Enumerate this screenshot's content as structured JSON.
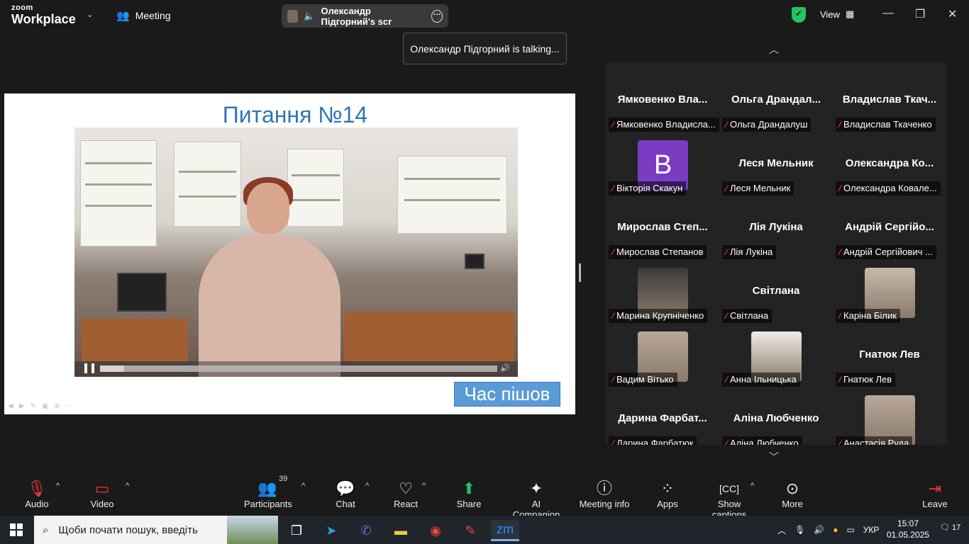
{
  "window": {
    "logo_top": "zoom",
    "logo_bottom": "Workplace",
    "meeting_label": "Meeting",
    "sharing_label": "Олександр Підгорний's scr",
    "view_label": "View",
    "talking_banner": "Олександр Підгорний is talking..."
  },
  "slide": {
    "title": "Питання №14",
    "overlay_text": "Час пішов",
    "video_progress": 0.06
  },
  "participants": [
    {
      "big_name": "Ямковенко Вла...",
      "label": "Ямковенко Владисла...",
      "kind": "name"
    },
    {
      "big_name": "Ольга Драндал...",
      "label": "Ольга Драндалуш",
      "kind": "name"
    },
    {
      "big_name": "Владислав Ткач...",
      "label": "Владислав Ткаченко",
      "kind": "name"
    },
    {
      "big_name": "B",
      "label": "Вікторія Скакун",
      "kind": "letter"
    },
    {
      "big_name": "Леся Мельник",
      "label": "Леся Мельник",
      "kind": "name"
    },
    {
      "big_name": "Олександра Ко...",
      "label": "Олександра Ковале...",
      "kind": "name"
    },
    {
      "big_name": "Мирослав Степ...",
      "label": "Мирослав Степанов",
      "kind": "name"
    },
    {
      "big_name": "Лія Лукіна",
      "label": "Лія Лукіна",
      "kind": "name"
    },
    {
      "big_name": "Андрій Сергійо...",
      "label": "Андрій Сергійович ...",
      "kind": "name"
    },
    {
      "big_name": "",
      "label": "Марина Крупніченко",
      "kind": "photo"
    },
    {
      "big_name": "Світлана",
      "label": "Світлана",
      "kind": "name"
    },
    {
      "big_name": "",
      "label": "Каріна Білик",
      "kind": "photo"
    },
    {
      "big_name": "",
      "label": "Вадим Вітько",
      "kind": "photo"
    },
    {
      "big_name": "",
      "label": "Анна Ільницька",
      "kind": "photo"
    },
    {
      "big_name": "Гнатюк Лев",
      "label": "Гнатюк Лев",
      "kind": "name"
    },
    {
      "big_name": "Дарина Фарбат...",
      "label": "Дарина Фарбатюк",
      "kind": "name"
    },
    {
      "big_name": "Аліна Любченко",
      "label": "Аліна Любченко",
      "kind": "name"
    },
    {
      "big_name": "",
      "label": "Анастасія Руда",
      "kind": "photo"
    }
  ],
  "toolbar": {
    "audio": "Audio",
    "video": "Video",
    "participants": "Participants",
    "participants_count": "39",
    "chat": "Chat",
    "react": "React",
    "share": "Share",
    "ai_companion": "AI Companion",
    "meeting_info": "Meeting info",
    "apps": "Apps",
    "captions": "Show captions",
    "more": "More",
    "leave": "Leave"
  },
  "taskbar": {
    "search_placeholder": "Щоби почати пошук, введіть",
    "language": "УКР",
    "time": "15:07",
    "date": "01.05.2025",
    "notifications": "17"
  },
  "colors": {
    "accent_green": "#23c55e",
    "slide_title": "#2e75b6",
    "overlay_box": "#5b9bd5",
    "mic_off": "#e53935"
  }
}
